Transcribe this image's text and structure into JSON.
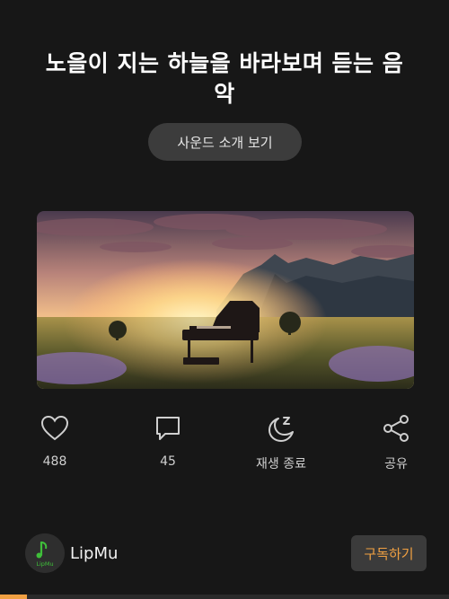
{
  "page": {
    "title": "노을이 지는 하늘을 바라보며 듣는 음악",
    "intro_button": "사운드 소개 보기"
  },
  "actions": [
    {
      "icon": "heart-icon",
      "label": "488"
    },
    {
      "icon": "comment-icon",
      "label": "45"
    },
    {
      "icon": "sleep-timer-icon",
      "label": "재생 종료"
    },
    {
      "icon": "share-icon",
      "label": "공유"
    }
  ],
  "channel": {
    "name": "LipMu",
    "logo_text": "LipMu",
    "subscribe_label": "구독하기"
  },
  "playback": {
    "progress": 0.06
  },
  "colors": {
    "background": "#171717",
    "accent": "#f0a042",
    "logo_green": "#3fbf3a"
  }
}
